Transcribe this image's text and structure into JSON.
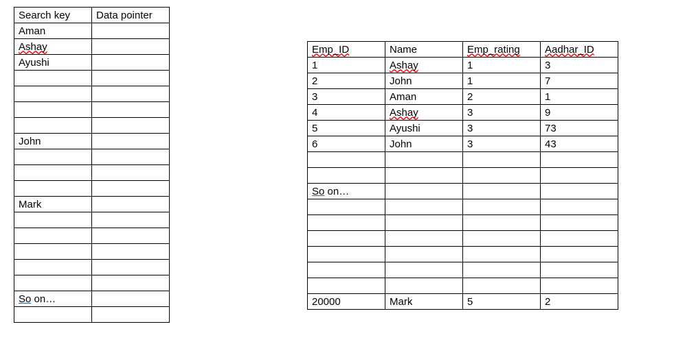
{
  "left_table": {
    "headers": [
      "Search key",
      "Data pointer"
    ],
    "rows": [
      [
        "Aman",
        ""
      ],
      [
        "Ashay",
        ""
      ],
      [
        "Ayushi",
        ""
      ],
      [
        "",
        ""
      ],
      [
        "",
        ""
      ],
      [
        "",
        ""
      ],
      [
        "",
        ""
      ],
      [
        "John",
        ""
      ],
      [
        "",
        ""
      ],
      [
        "",
        ""
      ],
      [
        "",
        ""
      ],
      [
        "Mark",
        ""
      ],
      [
        "",
        ""
      ],
      [
        "",
        ""
      ],
      [
        "",
        ""
      ],
      [
        "",
        ""
      ],
      [
        "",
        ""
      ],
      [
        "So on…",
        ""
      ],
      [
        "",
        ""
      ]
    ]
  },
  "right_table": {
    "headers": [
      "Emp_ID",
      "Name",
      "Emp_rating",
      "Aadhar_ID"
    ],
    "rows": [
      [
        "1",
        "Ashay",
        "1",
        "3"
      ],
      [
        "2",
        "John",
        "1",
        "7"
      ],
      [
        "3",
        "Aman",
        "2",
        "1"
      ],
      [
        "4",
        "Ashay",
        "3",
        "9"
      ],
      [
        "5",
        "Ayushi",
        "3",
        "73"
      ],
      [
        "6",
        "John",
        "3",
        "43"
      ],
      [
        "",
        "",
        "",
        ""
      ],
      [
        "",
        "",
        "",
        ""
      ],
      [
        "So on…",
        "",
        "",
        ""
      ],
      [
        "",
        "",
        "",
        ""
      ],
      [
        "",
        "",
        "",
        ""
      ],
      [
        "",
        "",
        "",
        ""
      ],
      [
        "",
        "",
        "",
        ""
      ],
      [
        "",
        "",
        "",
        ""
      ],
      [
        "",
        "",
        "",
        ""
      ],
      [
        "20000",
        "Mark",
        "5",
        "2"
      ]
    ]
  }
}
